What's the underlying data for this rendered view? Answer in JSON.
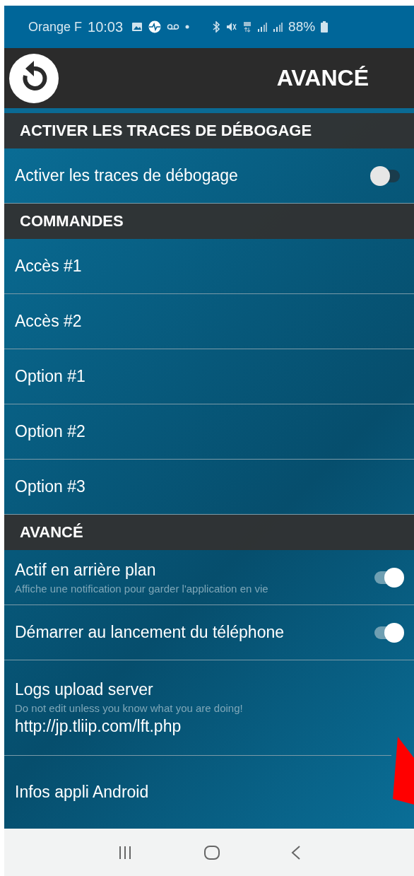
{
  "status_bar": {
    "carrier": "Orange F",
    "time": "10:03",
    "battery": "88%"
  },
  "header": {
    "title": "AVANCÉ"
  },
  "sections": [
    {
      "title": "ACTIVER LES TRACES DE DÉBOGAGE",
      "items": [
        {
          "kind": "toggle",
          "label": "Activer les traces de débogage",
          "on": false
        }
      ]
    },
    {
      "title": "COMMANDES",
      "items": [
        {
          "kind": "plain",
          "label": "Accès #1"
        },
        {
          "kind": "plain",
          "label": "Accès #2"
        },
        {
          "kind": "plain",
          "label": "Option #1"
        },
        {
          "kind": "plain",
          "label": "Option #2"
        },
        {
          "kind": "plain",
          "label": "Option #3"
        }
      ]
    },
    {
      "title": "AVANCÉ",
      "items": [
        {
          "kind": "toggle",
          "label": "Actif en arrière plan",
          "summary": "Affiche une notification pour garder l'application en vie",
          "on": true
        },
        {
          "kind": "toggle",
          "label": "Démarrer au lancement du téléphone",
          "on": true
        },
        {
          "kind": "text",
          "label": "Logs upload server",
          "summary": "Do not edit unless you know what you are doing!",
          "value": "http://jp.tliip.com/lft.php"
        },
        {
          "kind": "plain",
          "label": "Infos appli Android"
        }
      ]
    }
  ]
}
